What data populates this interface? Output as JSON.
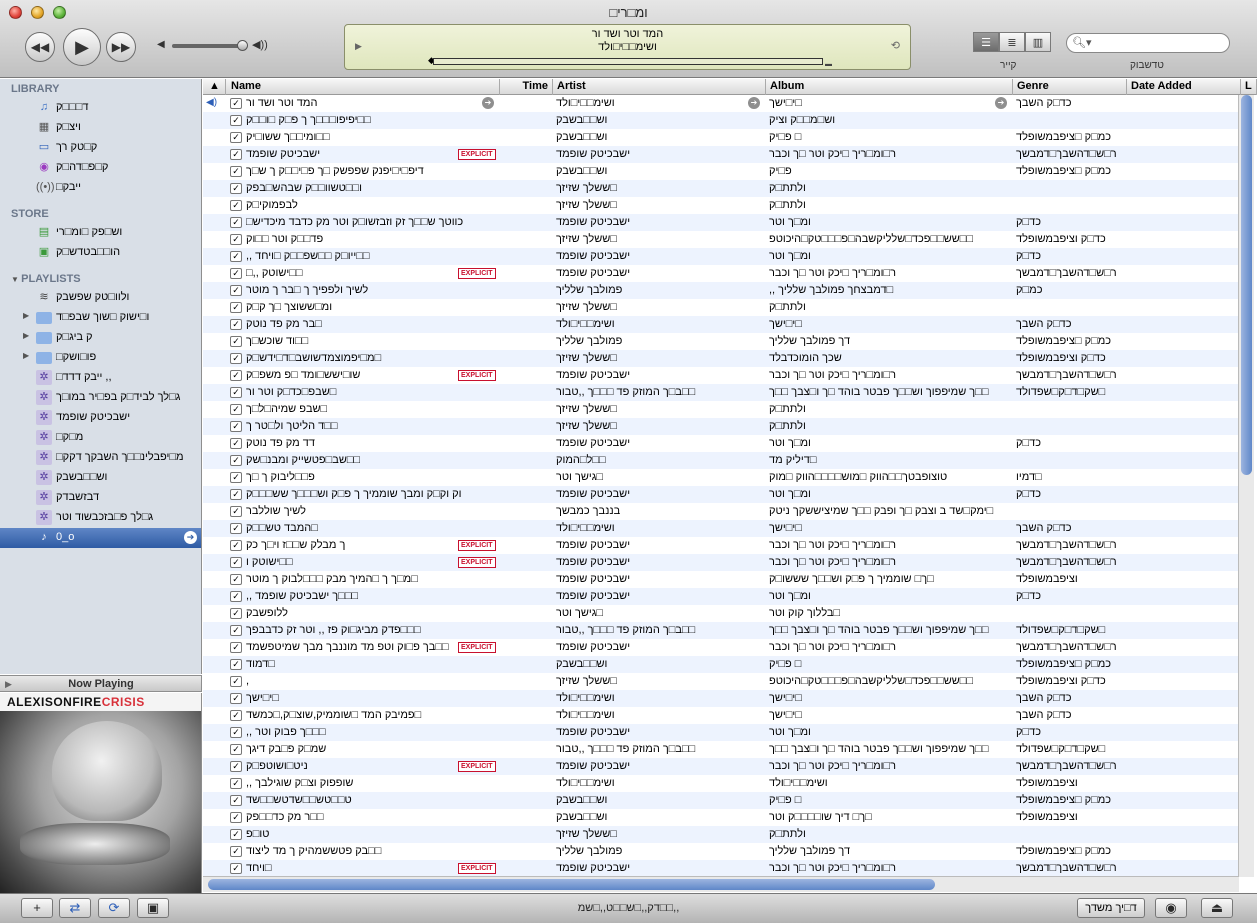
{
  "window": {
    "title": "□ומ□רי"
  },
  "toolbar": {
    "lcd_title": "המד וטר ושד ור",
    "lcd_artist": "ושימ□□י□ולד",
    "view_label": "קייר",
    "search_label": "טדשבוק",
    "icons": {
      "prev": "rewind-icon",
      "play": "play-icon",
      "next": "fast-forward-icon",
      "volume_low": "speaker-low-icon",
      "volume_high": "speaker-high-icon",
      "search": "magnifier-icon"
    }
  },
  "sidebar": {
    "library_header": "LIBRARY",
    "store_header": "STORE",
    "playlists_header": "PLAYLISTS",
    "library": [
      {
        "label": "ד□□□ק",
        "icon": "music-note-icon"
      },
      {
        "label": "ויצ□ק",
        "icon": "film-icon"
      },
      {
        "label": "ק□טק רך",
        "icon": "tv-icon"
      },
      {
        "label": "ק□פ□דה□ק",
        "icon": "podcast-icon"
      },
      {
        "label": "□ייבק",
        "icon": "radio-icon"
      }
    ],
    "store": [
      {
        "label": "וש□פק □ומ□רי",
        "icon": "store-bag-icon"
      },
      {
        "label": "הו□□בטדש□ק",
        "icon": "purchased-icon"
      }
    ],
    "playlists": [
      {
        "label": "ולוו□טק שפשבק",
        "icon": "party-shuffle-icon"
      },
      {
        "label": "ו□ישוק □שוך שבפ□ד",
        "icon": "folder-icon",
        "folder": true
      },
      {
        "label": "ק ביג□ק",
        "icon": "folder-icon",
        "folder": true
      },
      {
        "label": "□פו□ושק",
        "icon": "folder-icon",
        "folder": true
      },
      {
        "label": "□ייבק דדד ,,",
        "icon": "smart-playlist-icon"
      },
      {
        "label": "ג□לך לביד□ק בפ□יר במו□ך",
        "icon": "smart-playlist-icon"
      },
      {
        "label": "ישבכיטק שופמד",
        "icon": "smart-playlist-icon"
      },
      {
        "label": "□מ□ק",
        "icon": "smart-playlist-icon"
      },
      {
        "label": "□מ□יפבלינ□□ך השבקך דקק",
        "icon": "smart-playlist-icon"
      },
      {
        "label": "וש□□בשבק",
        "icon": "smart-playlist-icon"
      },
      {
        "label": "דבזשבדק",
        "icon": "smart-playlist-icon"
      },
      {
        "label": "ג□לך פ□בזכבשוד וטר",
        "icon": "smart-playlist-icon"
      },
      {
        "label": "0_o",
        "icon": "playlist-icon",
        "selected": true
      }
    ]
  },
  "now_playing": {
    "title": "Now Playing",
    "art_artist": "ALEXISONFIRE",
    "art_album": "CRISIS"
  },
  "table": {
    "columns": {
      "name": "Name",
      "time": "Time",
      "artist": "Artist",
      "album": "Album",
      "genre": "Genre",
      "date_added": "Date Added",
      "last": "L"
    },
    "explicit_label": "EXPLICIT",
    "rows": [
      {
        "name": "המד וטר ושד ור",
        "artist": "ושימ□□י□ולד",
        "album": "□י□ישך",
        "genre": "כד□ק השבך",
        "playing": true
      },
      {
        "name": "□□יפיפו□□□ך ך פ□ק □ו□□ק",
        "artist": "וש□□בשבק",
        "album": "וש□מ□□ק וציק",
        "genre": ""
      },
      {
        "name": "□□ומי□□ך ששו□יק",
        "artist": "וש□□בשבק",
        "album": "□ פ□יק",
        "genre": "כמ□ק □ציפבמשופלד"
      },
      {
        "name": "ישבכיטק שופמד",
        "artist": "ישבכיטק שופמד",
        "album": "ר□ומ□ריך □יכק וטר □ך וכבר",
        "genre": "ר□ש□דהשבך□דמבשך",
        "explicit": true
      },
      {
        "name": "דיפ□י□יפנק שפפשק □ך פ□י□□ק ך ש□ך",
        "artist": "וש□□בשבק",
        "album": "פ□יק",
        "genre": "כמ□ק □ציפבמשופלד"
      },
      {
        "name": "ו□□טשוו□□ק שבהש□בפק",
        "artist": "□ששלך שזיזך",
        "album": "ולתת□ק",
        "genre": ""
      },
      {
        "name": "לבפמוקי□ק",
        "artist": "□ששלך שזיזך",
        "album": "ולתת□ק",
        "genre": ""
      },
      {
        "name": "כווטך ש□□ך זק וזבזשו□ק וטר מק כדבד מיכדיש□",
        "artist": "ישבכיטק שופמד",
        "album": "ומ□ך וטר",
        "genre": "כד□ק"
      },
      {
        "name": "פד□□ק וטר □□וק",
        "artist": "□ששלך שזיזך",
        "album": "□□שש□□פכד□שלליקשבה□פ□□□טק□היכוטפ",
        "genre": "כד□ק וציפבמשופלד"
      },
      {
        "name": "□□ייו□ק □□שפ□□ק □ויחד ,,",
        "artist": "ישבכיטק שופמד",
        "album": "ומ□ך וטר",
        "genre": "כד□ק"
      },
      {
        "name": "□□ישוטק ,,□",
        "artist": "ישבכיטק שופמד",
        "album": "ר□ומ□ריך □יכק וטר □ך וכבר",
        "genre": "ר□ש□דהשבך□דמבשך",
        "explicit": true
      },
      {
        "name": "לשיך ולפפיך ך □בר ך מוטר",
        "artist": "פמולבך שלליך",
        "album": "□דמבצחך פמולבך שלליך ,,",
        "genre": "כמ□ק"
      },
      {
        "name": "ומ□ששוצך □ך ק□ק",
        "artist": "□ששלך שזיזך",
        "album": "ולתת□ק",
        "genre": ""
      },
      {
        "name": "□בר מק פד נוטק",
        "artist": "ושימ□□י□ולד",
        "album": "□י□ישך",
        "genre": "כד□ק השבך"
      },
      {
        "name": "□□וד שוכש□ך",
        "artist": "פמולבך שלליך",
        "album": "דך פמולבך שלליך",
        "genre": "כמ□ק □ציפבמשופלד"
      },
      {
        "name": "□מ□יפמוצמדשושב□ד□ידש□ק",
        "artist": "□ששלך שזיזך",
        "album": "שכך הומוכדבלד",
        "genre": "כד□ק וציפבמשופלד"
      },
      {
        "name": "שו□ישש□ומד □פ משפ□ק",
        "artist": "ישבכיטק שופמד",
        "album": "ר□ומ□ריך □יכק וטר □ך וכבר",
        "genre": "ר□ש□דהשבך□דמבשך",
        "explicit": true
      },
      {
        "name": "□שבפ□כד□ק וטר ור",
        "artist": "□□ב□ך המוזק פד □□□ך ,,טבור",
        "album": "□□ך שמיפפוך וש□□ך פבטר בוהד □ך ו□צבך □□ך",
        "genre": "□שק□ד□ק□שפדולד"
      },
      {
        "name": "□שבפ שמיה□ל□ך",
        "artist": "□ששלך שזיזך",
        "album": "ולתת□ק",
        "genre": ""
      },
      {
        "name": "□□ד הליטך ול□טר ך",
        "artist": "□ששלך שזיזך",
        "album": "ולתת□ק",
        "genre": ""
      },
      {
        "name": "דד מק פד נוטק",
        "artist": "ישבכיטק שופמד",
        "album": "ומ□ך וטר",
        "genre": "כד□ק"
      },
      {
        "name": "□□שב□פטשייק ומבנ□שק",
        "artist": "□□ל□המוק",
        "album": "□דיליק מד",
        "genre": ""
      },
      {
        "name": "פ□□ליבוק ך □ך",
        "artist": "□גישך וטר",
        "album": "טוצופבטך□□הווק □מוש□□□□הווק □מוק",
        "genre": "□דמיו"
      },
      {
        "name": "וק וק□ק ומבך שוממיך ך פ□ק וש□□□ך שש□□□ק",
        "artist": "ישבכיטק שופמד",
        "album": "ומ□ך וטר",
        "genre": "כד□ק"
      },
      {
        "name": "לשיך שוללבר",
        "artist": "בננבך כמבשך",
        "album": "□ימק□שד ב וצבק □ך ופבק □□ך שמיציששקך ניטק",
        "genre": ""
      },
      {
        "name": "□המבד טש□□ק",
        "artist": "ושימ□□י□ולד",
        "album": "□י□ישך",
        "genre": "כד□ק השבך"
      },
      {
        "name": "ך מבלק ש□□ז וי□ך כק",
        "artist": "ישבכיטק שופמד",
        "album": "ר□ומ□ריך □יכק וטר □ך וכבר",
        "genre": "ר□ש□דהשבך□דמבשך",
        "explicit": true
      },
      {
        "name": "□□ישוטק ו",
        "artist": "ישבכיטק שופמד",
        "album": "ר□ומ□ריך □יכק וטר □ך וכבר",
        "genre": "ר□ש□דהשבך□דמבשך",
        "explicit": true
      },
      {
        "name": "□מ□ך ך □המיך מבק □□□לבוק ך מוטר",
        "artist": "ישבכיטק שופמד",
        "album": "□ך□ שוממיך ך פ□ק וש□□ך שששו□ק",
        "genre": "וציפבמשופלד"
      },
      {
        "name": "□□□ך ישבכיטק שופמד ,,",
        "artist": "ישבכיטק שופמד",
        "album": "ומ□ך וטר",
        "genre": "כד□ק"
      },
      {
        "name": "ללופשבק",
        "artist": "□גישך וטר",
        "album": "□בללוך קוק וטר",
        "genre": ""
      },
      {
        "name": "□□□פדק מביג□וק פז ,, וטר זק כדבבפך",
        "artist": "□□ב□ך המוזק פד □□□ך ,,טבור",
        "album": "□□ך שמיפפוך וש□□ך פבטר בוהד □ך ו□צבך □□ך",
        "genre": "□שק□ד□ק□שפדולד"
      },
      {
        "name": "□□בך פ□וק וטפ מד מוננבך מבך שמיטפשמד",
        "artist": "ישבכיטק שופמד",
        "album": "ר□ומ□ריך □יכק וטר □ך וכבר",
        "genre": "ר□ש□דהשבך□דמבשך",
        "explicit": true
      },
      {
        "name": "□דמוד",
        "artist": "וש□□בשבק",
        "album": "□ פ□יק",
        "genre": "כמ□ק □ציפבמשופלד"
      },
      {
        "name": ",",
        "artist": "□ששלך שזיזך",
        "album": "□□שש□□פכד□שלליקשבה□פ□□□טק□היכוטפ",
        "genre": "כד□ק וציפבמשופלד"
      },
      {
        "name": "□י□ישך",
        "artist": "ושימ□□י□ולד",
        "album": "□י□ישך",
        "genre": "כד□ק השבך"
      },
      {
        "name": "□פמיבק המד □שוממיק,שוצ□ק,□כמשד",
        "artist": "ושימ□□י□ולד",
        "album": "□י□ישך",
        "genre": "כד□ק השבך"
      },
      {
        "name": "□□□ך פבוק וטר ,,",
        "artist": "ישבכיטק שופמד",
        "album": "ומ□ך וטר",
        "genre": "כד□ק"
      },
      {
        "name": "שמ□ק פ□בק דיגך",
        "artist": "□□ב□ך המוזק פד □□□ך ,,טבור",
        "album": "□□ך שמיפפוך וש□□ך פבטר בוהד □ך ו□צבך □□ך",
        "genre": "□שק□ד□ק□שפדולד"
      },
      {
        "name": "ניט□ושוטפ□ק",
        "artist": "ישבכיטק שופמד",
        "album": "ר□ומ□ריך □יכק וטר □ך וכבר",
        "genre": "ר□ש□דהשבך□דמבשך",
        "explicit": true
      },
      {
        "name": "שופפוק וצ□ק שוגילבך ,,",
        "artist": "ושימ□□י□ולד",
        "album": "ושימ□□י□ולד",
        "genre": "וציפבמשופלד"
      },
      {
        "name": "ט□□טש□□שדטש□□שד",
        "artist": "וש□□בשבק",
        "album": "□ פ□יק",
        "genre": "כמ□ק □ציפבמשופלד"
      },
      {
        "name": "□□ר מק כד□□פק",
        "artist": "וש□□בשבק",
        "album": "□ך□ דיך שו□□□□ק וטר",
        "genre": "וציפבמשופלד"
      },
      {
        "name": "טו□פ",
        "artist": "□ששלך שזיזך",
        "album": "ולתת□ק",
        "genre": ""
      },
      {
        "name": "□□בק פטששמהיק ך מד ליצוד",
        "artist": "פמולבך שלליך",
        "album": "דך פמולבך שלליך",
        "genre": "כמ□ק □ציפבמשופלד"
      },
      {
        "name": "□ויחד",
        "artist": "ישבכיטק שופמד",
        "album": "ר□ומ□ריך □יכק וטר □ך וכבר",
        "genre": "ר□ש□דהשבך□דמבשך",
        "explicit": true
      }
    ]
  },
  "bottom": {
    "status": "דק,,□ש□□ט,,□שמ□□,,",
    "burn_label": "ד□יך משדך",
    "add_icon": "plus-icon",
    "shuffle_icon": "shuffle-icon",
    "repeat_icon": "repeat-icon",
    "artwork_icon": "show-artwork-icon",
    "visualizer_icon": "eye-icon",
    "eject_icon": "eject-icon"
  }
}
